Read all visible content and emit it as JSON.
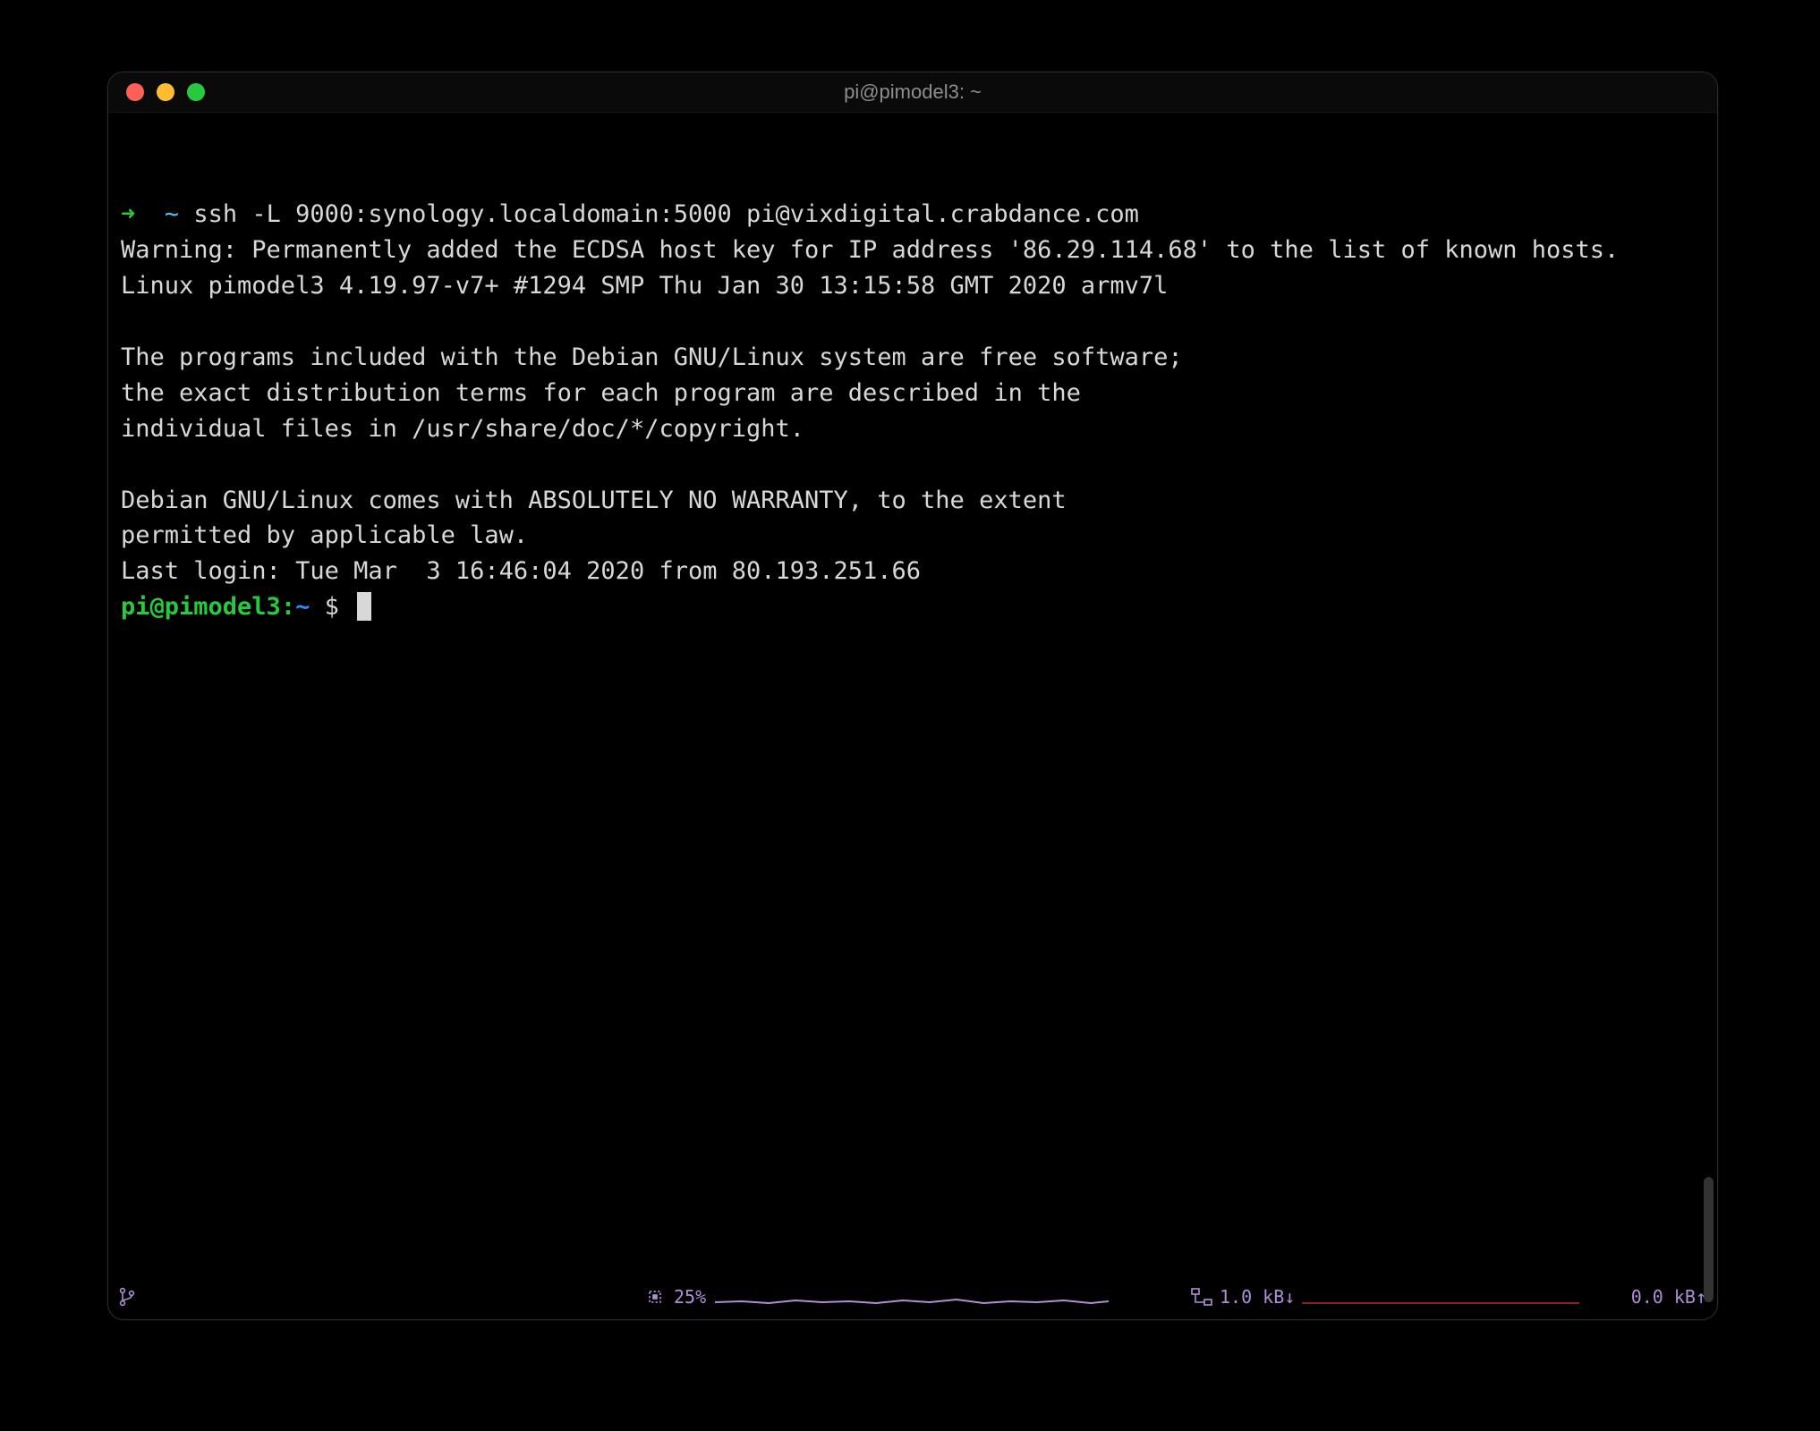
{
  "window": {
    "title": "pi@pimodel3: ~"
  },
  "prompt1": {
    "arrow": "➜",
    "tilde": "~",
    "command": "ssh -L 9000:synology.localdomain:5000 pi@vixdigital.crabdance.com"
  },
  "output": {
    "warning": "Warning: Permanently added the ECDSA host key for IP address '86.29.114.68' to the list of known hosts.",
    "uname": "Linux pimodel3 4.19.97-v7+ #1294 SMP Thu Jan 30 13:15:58 GMT 2020 armv7l",
    "motd1": "The programs included with the Debian GNU/Linux system are free software;",
    "motd2": "the exact distribution terms for each program are described in the",
    "motd3": "individual files in /usr/share/doc/*/copyright.",
    "motd4": "Debian GNU/Linux comes with ABSOLUTELY NO WARRANTY, to the extent",
    "motd5": "permitted by applicable law.",
    "lastlogin": "Last login: Tue Mar  3 16:46:04 2020 from 80.193.251.66"
  },
  "prompt2": {
    "user": "pi@pimodel3",
    "sep": ":",
    "path": "~",
    "dollar": " $ "
  },
  "statusbar": {
    "cpu_label": "25%",
    "net_down": "1.0 kB↓",
    "net_up": "0.0 kB↑"
  }
}
